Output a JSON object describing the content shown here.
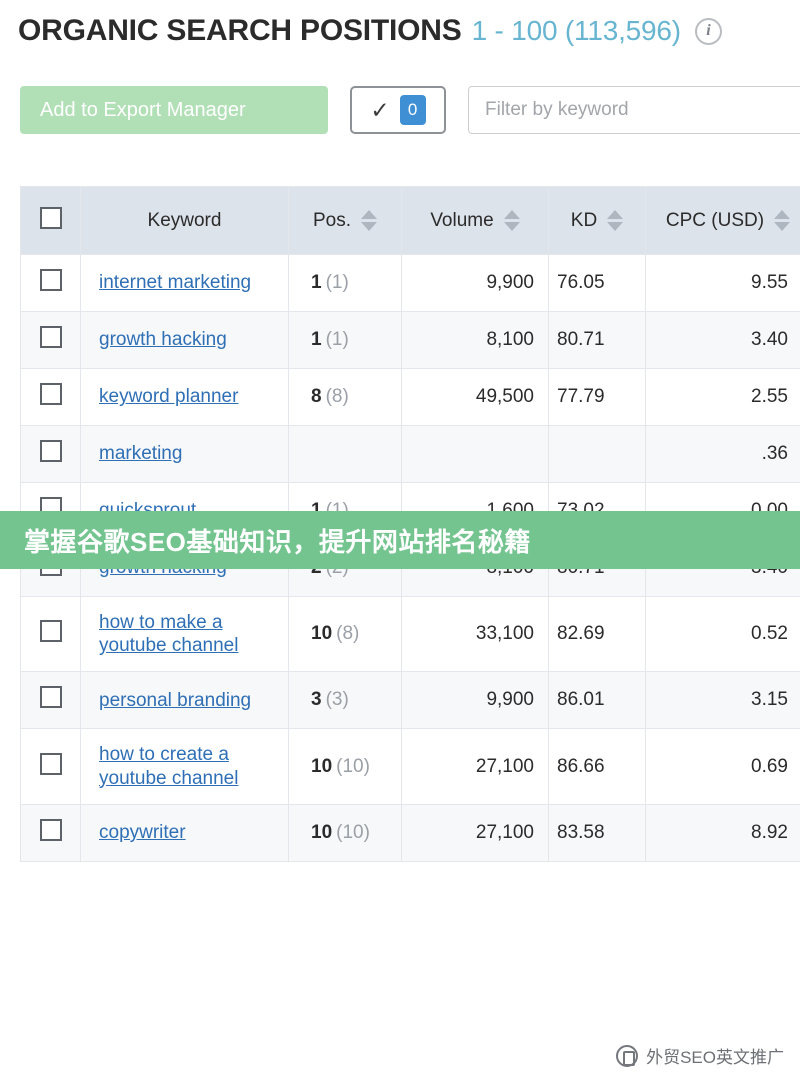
{
  "header": {
    "title": "ORGANIC SEARCH POSITIONS",
    "range": "1 - 100 (113,596)",
    "info_icon": "info-icon"
  },
  "toolbar": {
    "export_label": "Add to Export Manager",
    "check_glyph": "✓",
    "selected_count": "0",
    "filter_placeholder": "Filter by keyword",
    "filter_value": ""
  },
  "table": {
    "columns": [
      {
        "key": "check",
        "label": "",
        "sortable": false
      },
      {
        "key": "keyword",
        "label": "Keyword",
        "sortable": false
      },
      {
        "key": "pos",
        "label": "Pos.",
        "sortable": true
      },
      {
        "key": "volume",
        "label": "Volume",
        "sortable": true
      },
      {
        "key": "kd",
        "label": "KD",
        "sortable": true
      },
      {
        "key": "cpc",
        "label": "CPC (USD)",
        "sortable": true
      }
    ],
    "rows": [
      {
        "keyword": "internet marketing",
        "pos": "1",
        "pos_prev": "(1)",
        "volume": "9,900",
        "kd": "76.05",
        "cpc": "9.55"
      },
      {
        "keyword": "growth hacking",
        "pos": "1",
        "pos_prev": "(1)",
        "volume": "8,100",
        "kd": "80.71",
        "cpc": "3.40"
      },
      {
        "keyword": "keyword planner",
        "pos": "8",
        "pos_prev": "(8)",
        "volume": "49,500",
        "kd": "77.79",
        "cpc": "2.55"
      },
      {
        "keyword": "marketing",
        "pos": "",
        "pos_prev": "",
        "volume": "",
        "kd": "",
        "cpc": ".36"
      },
      {
        "keyword": "quicksprout",
        "pos": "1",
        "pos_prev": "(1)",
        "volume": "1,600",
        "kd": "73.02",
        "cpc": "0.00"
      },
      {
        "keyword": "growth hacking",
        "pos": "2",
        "pos_prev": "(2)",
        "volume": "8,100",
        "kd": "80.71",
        "cpc": "3.40"
      },
      {
        "keyword": "how to make a youtube channel",
        "pos": "10",
        "pos_prev": "(8)",
        "volume": "33,100",
        "kd": "82.69",
        "cpc": "0.52"
      },
      {
        "keyword": "personal branding",
        "pos": "3",
        "pos_prev": "(3)",
        "volume": "9,900",
        "kd": "86.01",
        "cpc": "3.15"
      },
      {
        "keyword": "how to create a youtube channel",
        "pos": "10",
        "pos_prev": "(10)",
        "volume": "27,100",
        "kd": "86.66",
        "cpc": "0.69"
      },
      {
        "keyword": "copywriter",
        "pos": "10",
        "pos_prev": "(10)",
        "volume": "27,100",
        "kd": "83.58",
        "cpc": "8.92"
      }
    ]
  },
  "banner": {
    "text": "掌握谷歌SEO基础知识，提升网站排名秘籍",
    "color": "#74c490"
  },
  "watermark": {
    "text": "外贸SEO英文推广",
    "logo": "wechat-logo-icon"
  },
  "colors": {
    "accent_blue": "#3e8fd4",
    "link_blue": "#2f6fb5",
    "range_blue": "#67b5d1",
    "header_row": "#dde3eb",
    "export_green": "#b2e0b6",
    "banner_green": "#74c490"
  }
}
